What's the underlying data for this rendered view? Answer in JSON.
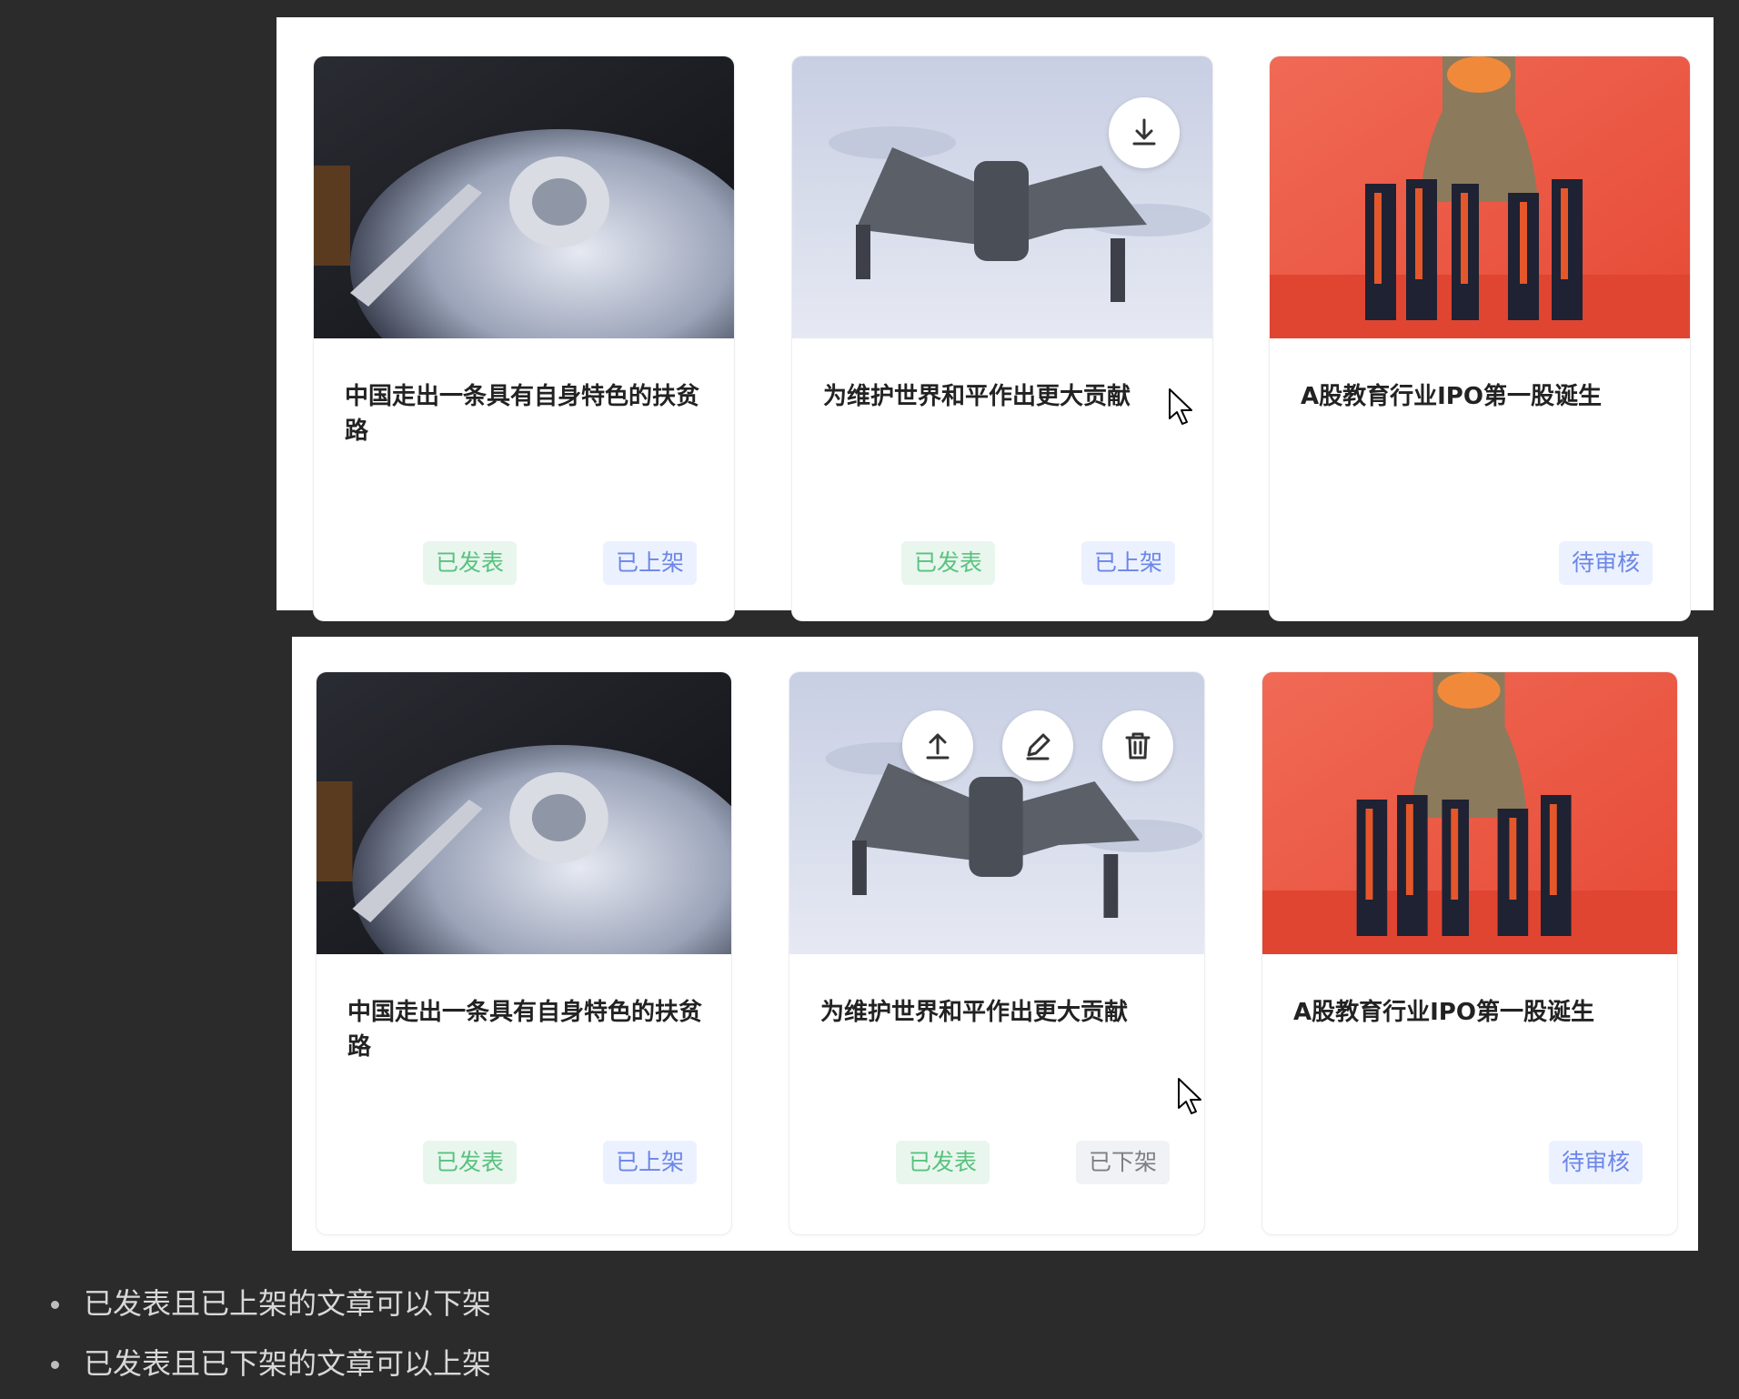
{
  "panels": [
    {
      "cards": [
        {
          "title": "中国走出一条具有自身特色的扶贫路",
          "publish_status": "已发表",
          "shelf_status": "已上架"
        },
        {
          "title": "为维护世界和平作出更大贡献",
          "publish_status": "已发表",
          "shelf_status": "已上架",
          "hover_actions": [
            "download-icon"
          ]
        },
        {
          "title": "A股教育行业IPO第一股诞生",
          "review_status": "待审核"
        }
      ]
    },
    {
      "cards": [
        {
          "title": "中国走出一条具有自身特色的扶贫路",
          "publish_status": "已发表",
          "shelf_status": "已上架"
        },
        {
          "title": "为维护世界和平作出更大贡献",
          "publish_status": "已发表",
          "shelf_status": "已下架",
          "hover_actions": [
            "upload-icon",
            "edit-icon",
            "trash-icon"
          ]
        },
        {
          "title": "A股教育行业IPO第一股诞生",
          "review_status": "待审核"
        }
      ]
    }
  ],
  "notes": [
    "已发表且已上架的文章可以下架",
    "已发表且已下架的文章可以上架"
  ],
  "colors": {
    "background": "#2b2b2b",
    "tag_green_text": "#59c27f",
    "tag_blue_text": "#6b86e8",
    "tag_grey_text": "#7c7f86"
  }
}
